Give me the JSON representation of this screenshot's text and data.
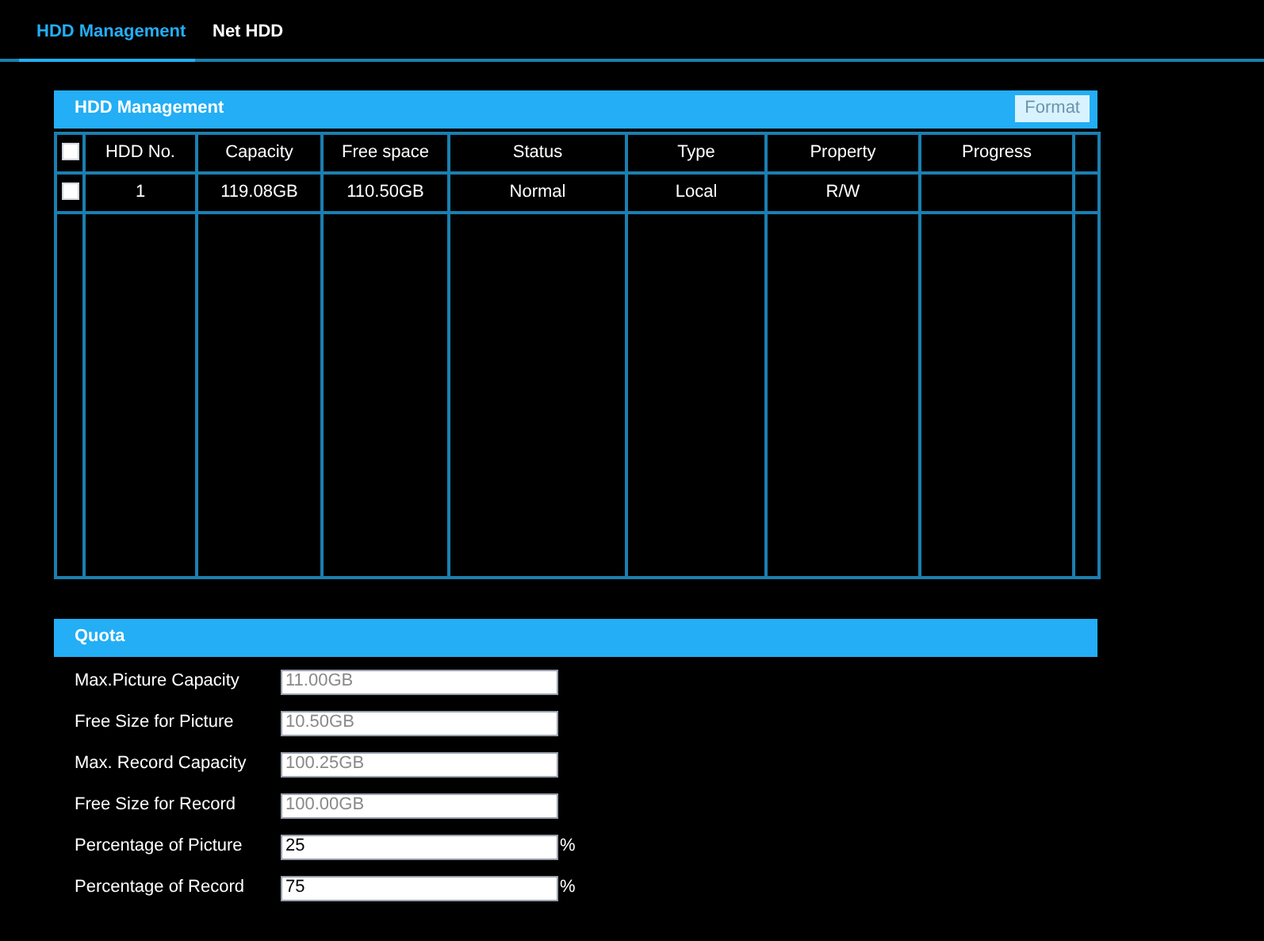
{
  "tabs": [
    {
      "label": "HDD Management",
      "selected": true
    },
    {
      "label": "Net HDD",
      "selected": false
    }
  ],
  "hdd_panel": {
    "title": "HDD Management",
    "format_button": "Format",
    "select_all_checked": false,
    "columns": [
      "HDD No.",
      "Capacity",
      "Free space",
      "Status",
      "Type",
      "Property",
      "Progress"
    ],
    "rows": [
      {
        "checked": false,
        "cells": [
          "1",
          "119.08GB",
          "110.50GB",
          "Normal",
          "Local",
          "R/W",
          ""
        ]
      }
    ]
  },
  "quota": {
    "title": "Quota",
    "fields": [
      {
        "label": "Max.Picture Capacity",
        "value": "11.00GB",
        "disabled": true
      },
      {
        "label": "Free Size for Picture",
        "value": "10.50GB",
        "disabled": true
      },
      {
        "label": "Max. Record Capacity",
        "value": "100.25GB",
        "disabled": true
      },
      {
        "label": "Free Size for Record",
        "value": "100.00GB",
        "disabled": true
      },
      {
        "label": "Percentage of Picture",
        "value": "25",
        "disabled": false,
        "unit": "%"
      },
      {
        "label": "Percentage of Record",
        "value": "75",
        "disabled": false,
        "unit": "%"
      }
    ]
  }
}
